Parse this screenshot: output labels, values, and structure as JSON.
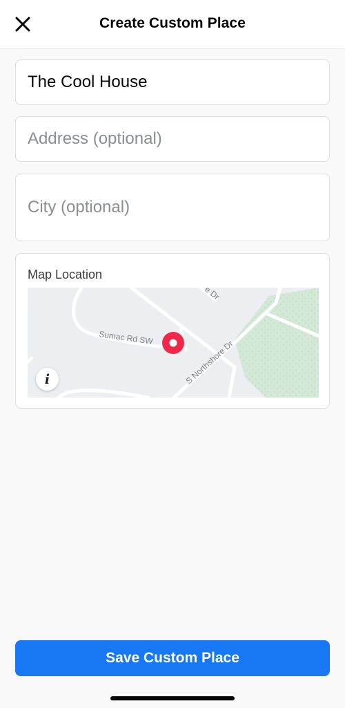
{
  "header": {
    "title": "Create Custom Place",
    "close_icon": "close-icon"
  },
  "form": {
    "name_value": "The Cool House",
    "name_placeholder": "",
    "address_value": "",
    "address_placeholder": "Address (optional)",
    "city_value": "",
    "city_placeholder": "City (optional)"
  },
  "map": {
    "label": "Map Location",
    "street_labels": {
      "sumac": "Sumac Rd SW",
      "northshore": "S Northshore Dr",
      "top_fragment": "e Dr"
    },
    "info_glyph": "i",
    "pin_icon": "location-pin-icon",
    "colors": {
      "background": "#eceef2",
      "road": "#ffffff",
      "park": "#d3e8d7",
      "pin": "#f02849"
    }
  },
  "footer": {
    "save_label": "Save Custom Place"
  },
  "colors": {
    "accent": "#1877f2"
  }
}
